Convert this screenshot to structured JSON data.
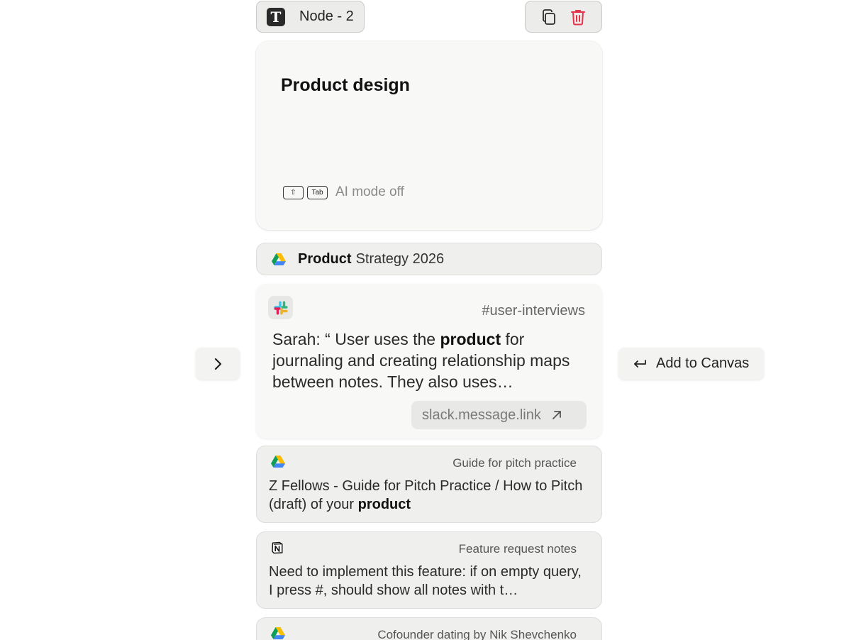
{
  "node": {
    "title": "Node - 2",
    "type_icon": "text-node-icon",
    "actions": [
      {
        "name": "duplicate",
        "icon": "copy-icon"
      },
      {
        "name": "delete",
        "icon": "trash-icon",
        "color": "#e5334b"
      }
    ]
  },
  "editor": {
    "title": "Product design",
    "keys": [
      "⇧",
      "Tab"
    ],
    "ai_mode_label": "AI mode off"
  },
  "results": {
    "drive": {
      "icon": "google-drive-icon",
      "title_bold": "Product",
      "title_rest": "Strategy 2026"
    },
    "slack": {
      "icon": "slack-icon",
      "channel": "#user-interviews",
      "message_pre": "Sarah: “ User uses the ",
      "message_bold": "product",
      "message_post": " for journaling and creating relationship maps between notes. They also uses…",
      "link": "slack.message.link"
    },
    "pitch": {
      "icon": "google-drive-icon",
      "title": "Guide for pitch practice",
      "body_pre": "Z Fellows - Guide for Pitch Practice / How to Pitch (draft) of your ",
      "body_bold": "product"
    },
    "notion": {
      "icon": "notion-icon",
      "title": "Feature request notes",
      "body": "Need to implement this feature: if on empty query, I press #, should show all notes with t…"
    },
    "cofounder": {
      "icon": "google-drive-icon",
      "title": "Cofounder dating by Nik Shevchenko"
    }
  },
  "controls": {
    "next_icon": "chevron-right-icon",
    "add_icon": "return-arrow-icon",
    "add_label": "Add to Canvas"
  },
  "colors": {
    "delete": "#e5334b",
    "background": "#ffffff",
    "card": "#f8f8f7",
    "pill": "#ececeb"
  }
}
